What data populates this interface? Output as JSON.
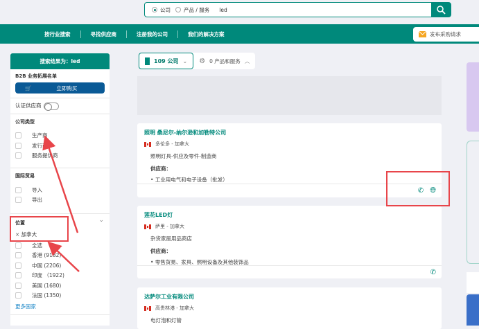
{
  "search": {
    "option_company": "公司",
    "option_product": "产品 / 服务",
    "query": "led",
    "selected": "company"
  },
  "nav": {
    "items": [
      "按行业搜索",
      "寻找供应商",
      "注册我的公司",
      "我们的解决方案"
    ],
    "post_request": "发布采购请求"
  },
  "sidebar": {
    "header": "搜索结果为：led",
    "b2b_title": "B2B 业务拓展名单",
    "buy_button": "立即购买",
    "certified_label": "认证供应商",
    "certified_on": false,
    "company_type": {
      "title": "公司类型",
      "items": [
        "生产商",
        "发行商",
        "服务提供商"
      ]
    },
    "trade": {
      "title": "国际贸易",
      "items": [
        "导入",
        "导出"
      ]
    },
    "location": {
      "title": "位置",
      "active_filter": "加拿大",
      "items": [
        "全选",
        "香港 (9182)",
        "中国 (2206)",
        "印度 （1922)",
        "美国 (1680)",
        "法国 (1350)"
      ],
      "more": "更多国家"
    }
  },
  "tabs": {
    "companies": "109 公司",
    "products": "0 产品和服务",
    "active": "companies"
  },
  "results": [
    {
      "name": "照明 桑尼尔-纳尔逊和加勒特公司",
      "location": "多伦多 - 加拿大",
      "desc": "照明灯具-供应及零件-制造商",
      "supplier_label": "供应商：",
      "supplies": "工业用电气和电子设备（批发）",
      "icons": [
        "phone-icon",
        "globe-icon"
      ]
    },
    {
      "name": "莲花LED灯",
      "location": "萨里 - 加拿大",
      "desc": "杂货家居用品商店",
      "supplier_label": "供应商：",
      "supplies": "零售贸易、家具、照明设备及其他装饰品",
      "icons": [
        "phone-icon"
      ]
    },
    {
      "name": "达萨尔工业有限公司",
      "location": "高贵林港 - 加拿大",
      "desc": "电灯泡和灯管"
    }
  ],
  "colors": {
    "brand": "#00897b",
    "buy": "#0a5a96",
    "annotation": "#e8454a"
  }
}
